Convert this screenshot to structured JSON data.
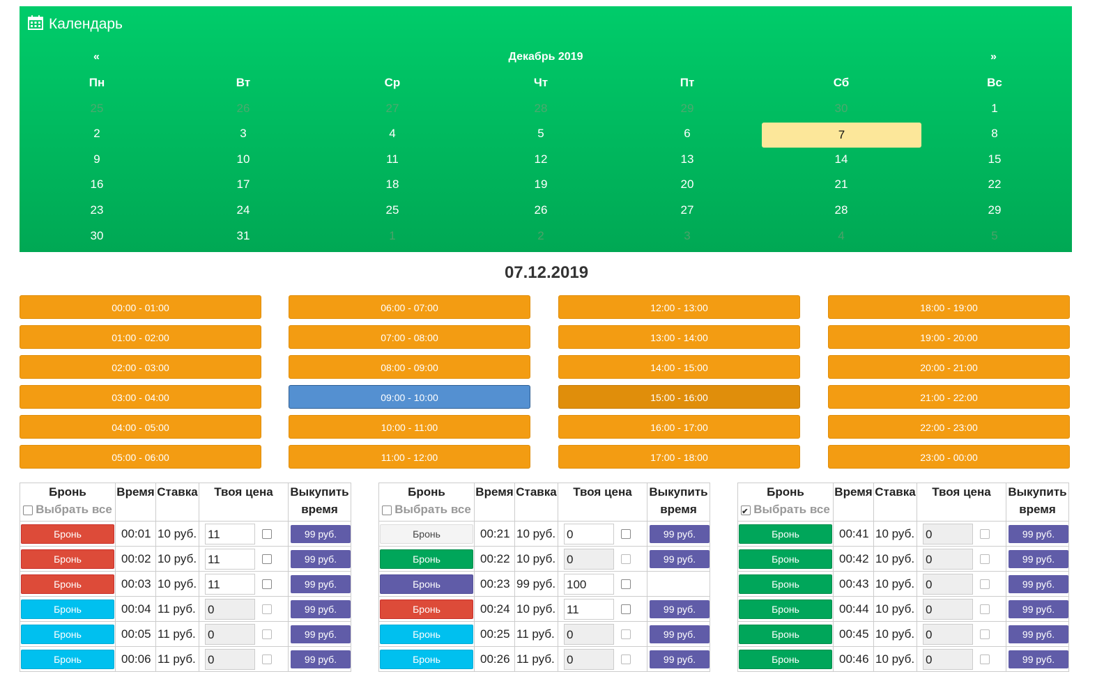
{
  "calendar": {
    "title": "Календарь",
    "prev": "«",
    "next": "»",
    "month": "Декабрь 2019",
    "weekdays": [
      "Пн",
      "Вт",
      "Ср",
      "Чт",
      "Пт",
      "Сб",
      "Вс"
    ],
    "weeks": [
      [
        {
          "d": "25",
          "muted": true
        },
        {
          "d": "26",
          "muted": true
        },
        {
          "d": "27",
          "muted": true
        },
        {
          "d": "28",
          "muted": true
        },
        {
          "d": "29",
          "muted": true
        },
        {
          "d": "30",
          "muted": true
        },
        {
          "d": "1"
        }
      ],
      [
        {
          "d": "2"
        },
        {
          "d": "3"
        },
        {
          "d": "4"
        },
        {
          "d": "5"
        },
        {
          "d": "6"
        },
        {
          "d": "7",
          "selected": true
        },
        {
          "d": "8"
        }
      ],
      [
        {
          "d": "9"
        },
        {
          "d": "10"
        },
        {
          "d": "11"
        },
        {
          "d": "12"
        },
        {
          "d": "13"
        },
        {
          "d": "14"
        },
        {
          "d": "15"
        }
      ],
      [
        {
          "d": "16"
        },
        {
          "d": "17"
        },
        {
          "d": "18"
        },
        {
          "d": "19"
        },
        {
          "d": "20"
        },
        {
          "d": "21"
        },
        {
          "d": "22"
        }
      ],
      [
        {
          "d": "23"
        },
        {
          "d": "24"
        },
        {
          "d": "25"
        },
        {
          "d": "26"
        },
        {
          "d": "27"
        },
        {
          "d": "28"
        },
        {
          "d": "29"
        }
      ],
      [
        {
          "d": "30"
        },
        {
          "d": "31"
        },
        {
          "d": "1",
          "muted": true
        },
        {
          "d": "2",
          "muted": true
        },
        {
          "d": "3",
          "muted": true
        },
        {
          "d": "4",
          "muted": true
        },
        {
          "d": "5",
          "muted": true
        }
      ]
    ]
  },
  "selected_date": "07.12.2019",
  "slots": [
    [
      "00:00 - 01:00",
      "01:00 - 02:00",
      "02:00 - 03:00",
      "03:00 - 04:00",
      "04:00 - 05:00",
      "05:00 - 06:00"
    ],
    [
      "06:00 - 07:00",
      "07:00 - 08:00",
      "08:00 - 09:00",
      "09:00 - 10:00",
      "10:00 - 11:00",
      "11:00 - 12:00"
    ],
    [
      "12:00 - 13:00",
      "13:00 - 14:00",
      "14:00 - 15:00",
      "15:00 - 16:00",
      "16:00 - 17:00",
      "17:00 - 18:00"
    ],
    [
      "18:00 - 19:00",
      "19:00 - 20:00",
      "20:00 - 21:00",
      "21:00 - 22:00",
      "22:00 - 23:00",
      "23:00 - 00:00"
    ]
  ],
  "slot_states": {
    "09:00 - 10:00": "active",
    "15:00 - 16:00": "pressed"
  },
  "table_headers": {
    "book": "Бронь",
    "select_all": "Выбрать все",
    "time": "Время",
    "rate": "Ставка",
    "your_price": "Твоя цена",
    "buy": "Выкупить время"
  },
  "tables": [
    {
      "select_all_checked": false,
      "rows": [
        {
          "btn": "Бронь",
          "color": "red",
          "time": "00:01",
          "rate": "10 руб.",
          "price": "11",
          "price_enabled": true,
          "buy": "99 руб."
        },
        {
          "btn": "Бронь",
          "color": "red",
          "time": "00:02",
          "rate": "10 руб.",
          "price": "11",
          "price_enabled": true,
          "buy": "99 руб."
        },
        {
          "btn": "Бронь",
          "color": "red",
          "time": "00:03",
          "rate": "10 руб.",
          "price": "11",
          "price_enabled": true,
          "buy": "99 руб."
        },
        {
          "btn": "Бронь",
          "color": "cyan",
          "time": "00:04",
          "rate": "11 руб.",
          "price": "0",
          "price_enabled": false,
          "buy": "99 руб."
        },
        {
          "btn": "Бронь",
          "color": "cyan",
          "time": "00:05",
          "rate": "11 руб.",
          "price": "0",
          "price_enabled": false,
          "buy": "99 руб."
        },
        {
          "btn": "Бронь",
          "color": "cyan",
          "time": "00:06",
          "rate": "11 руб.",
          "price": "0",
          "price_enabled": false,
          "buy": "99 руб."
        }
      ]
    },
    {
      "select_all_checked": false,
      "rows": [
        {
          "btn": "Бронь",
          "color": "light",
          "time": "00:21",
          "rate": "10 руб.",
          "price": "0",
          "price_enabled": true,
          "buy": "99 руб."
        },
        {
          "btn": "Бронь",
          "color": "green",
          "time": "00:22",
          "rate": "10 руб.",
          "price": "0",
          "price_enabled": false,
          "buy": "99 руб."
        },
        {
          "btn": "Бронь",
          "color": "purple",
          "time": "00:23",
          "rate": "99 руб.",
          "price": "100",
          "price_enabled": true,
          "buy": ""
        },
        {
          "btn": "Бронь",
          "color": "red",
          "time": "00:24",
          "rate": "10 руб.",
          "price": "11",
          "price_enabled": true,
          "buy": "99 руб."
        },
        {
          "btn": "Бронь",
          "color": "cyan",
          "time": "00:25",
          "rate": "11 руб.",
          "price": "0",
          "price_enabled": false,
          "buy": "99 руб."
        },
        {
          "btn": "Бронь",
          "color": "cyan",
          "time": "00:26",
          "rate": "11 руб.",
          "price": "0",
          "price_enabled": false,
          "buy": "99 руб."
        }
      ]
    },
    {
      "select_all_checked": true,
      "rows": [
        {
          "btn": "Бронь",
          "color": "green",
          "time": "00:41",
          "rate": "10 руб.",
          "price": "0",
          "price_enabled": false,
          "buy": "99 руб."
        },
        {
          "btn": "Бронь",
          "color": "green",
          "time": "00:42",
          "rate": "10 руб.",
          "price": "0",
          "price_enabled": false,
          "buy": "99 руб."
        },
        {
          "btn": "Бронь",
          "color": "green",
          "time": "00:43",
          "rate": "10 руб.",
          "price": "0",
          "price_enabled": false,
          "buy": "99 руб."
        },
        {
          "btn": "Бронь",
          "color": "green",
          "time": "00:44",
          "rate": "10 руб.",
          "price": "0",
          "price_enabled": false,
          "buy": "99 руб."
        },
        {
          "btn": "Бронь",
          "color": "green",
          "time": "00:45",
          "rate": "10 руб.",
          "price": "0",
          "price_enabled": false,
          "buy": "99 руб."
        },
        {
          "btn": "Бронь",
          "color": "green",
          "time": "00:46",
          "rate": "10 руб.",
          "price": "0",
          "price_enabled": false,
          "buy": "99 руб."
        }
      ]
    }
  ]
}
